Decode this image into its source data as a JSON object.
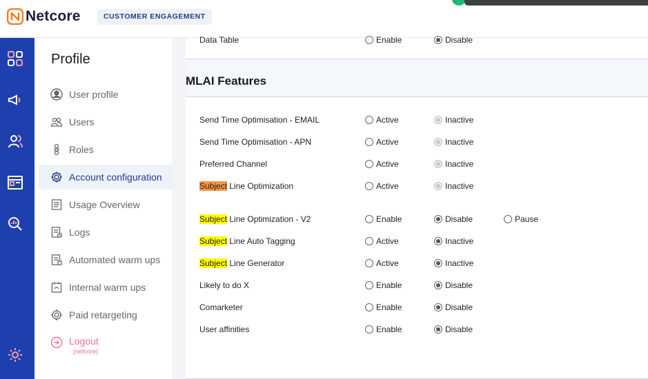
{
  "brand": {
    "name": "Netcore",
    "chip": "CUSTOMER ENGAGEMENT"
  },
  "sidebar": {
    "title": "Profile",
    "items": [
      {
        "label": "User profile",
        "icon": "user-circle-icon"
      },
      {
        "label": "Users",
        "icon": "users-icon"
      },
      {
        "label": "Roles",
        "icon": "roles-icon"
      },
      {
        "label": "Account configuration",
        "icon": "gear-icon",
        "active": true
      },
      {
        "label": "Usage Overview",
        "icon": "document-icon"
      },
      {
        "label": "Logs",
        "icon": "logs-icon"
      },
      {
        "label": "Automated warm ups",
        "icon": "automated-icon"
      },
      {
        "label": "Internal warm ups",
        "icon": "internal-icon"
      },
      {
        "label": "Paid retargeting",
        "icon": "target-icon"
      }
    ],
    "logout": {
      "label": "Logout",
      "sub": "(netcore)"
    }
  },
  "rail": [
    "dashboard-icon",
    "megaphone-icon",
    "audience-icon",
    "window-icon",
    "analytics-icon",
    "settings-icon"
  ],
  "top_row": {
    "label": "Data Table",
    "opt1": "Enable",
    "opt2": "Disable",
    "selected": 2
  },
  "section": {
    "title": "MLAI Features"
  },
  "features": [
    {
      "hl": "",
      "text": "Send Time Optimisation - EMAIL",
      "opt1": "Active",
      "opt2": "Inactive",
      "sel": 2,
      "disabled2": true
    },
    {
      "hl": "",
      "text": "Send Time Optimisation - APN",
      "opt1": "Active",
      "opt2": "Inactive",
      "sel": 2,
      "disabled2": true
    },
    {
      "hl": "",
      "text": "Preferred Channel",
      "opt1": "Active",
      "opt2": "Inactive",
      "sel": 2,
      "disabled2": true
    },
    {
      "hl": "Subject",
      "hlcolor": "orange",
      "text": " Line Optimization",
      "opt1": "Active",
      "opt2": "Inactive",
      "sel": 2,
      "disabled2": true
    },
    {
      "hl": "Subject",
      "hlcolor": "yellow",
      "text": " Line Optimization - V2",
      "opt1": "Enable",
      "opt2": "Disable",
      "opt3": "Pause",
      "sel": 2
    },
    {
      "hl": "Subject",
      "hlcolor": "yellow",
      "text": " Line Auto Tagging",
      "opt1": "Active",
      "opt2": "Inactive",
      "sel": 2
    },
    {
      "hl": "Subject",
      "hlcolor": "yellow",
      "text": " Line Generator",
      "opt1": "Active",
      "opt2": "Inactive",
      "sel": 2
    },
    {
      "hl": "",
      "text": "Likely to do X",
      "opt1": "Enable",
      "opt2": "Disable",
      "sel": 2
    },
    {
      "hl": "",
      "text": "Comarketer",
      "opt1": "Enable",
      "opt2": "Disable",
      "sel": 2
    },
    {
      "hl": "",
      "text": "User affinities",
      "opt1": "Enable",
      "opt2": "Disable",
      "sel": 2
    }
  ]
}
